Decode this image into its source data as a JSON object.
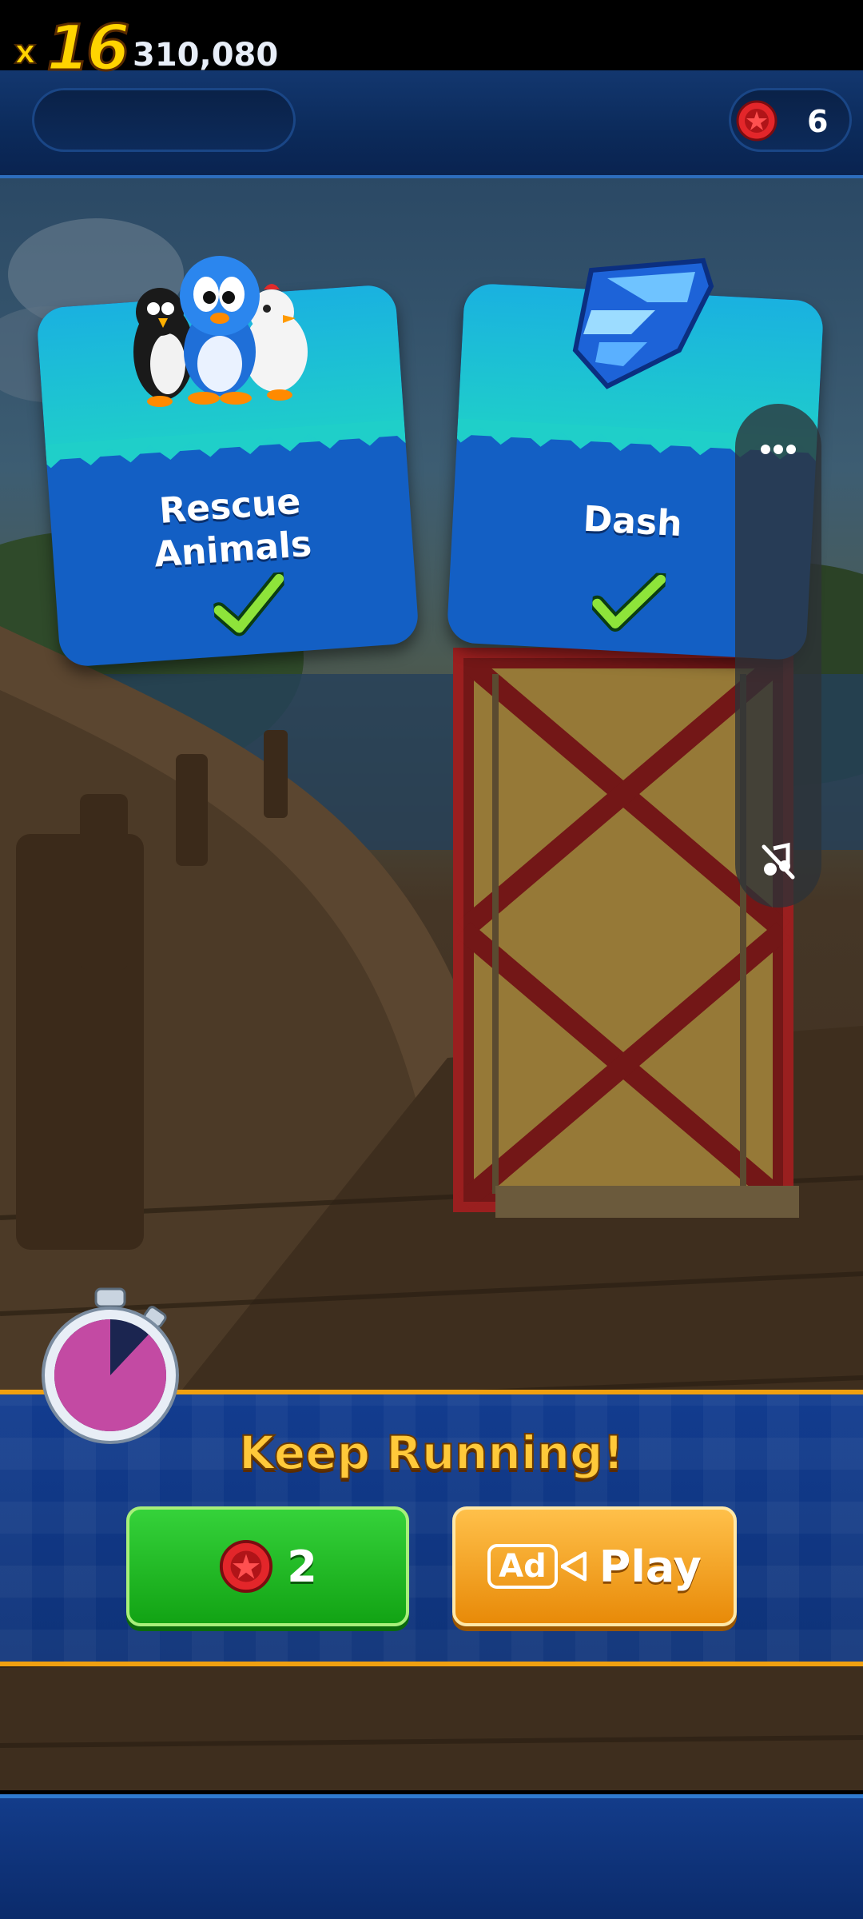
{
  "hud": {
    "multiplier_prefix": "x",
    "multiplier": "16",
    "score": "310,080",
    "red_rings": "6"
  },
  "cards": [
    {
      "label_line1": "Rescue",
      "label_line2": "Animals",
      "completed": true,
      "art": "animal-friends-icon"
    },
    {
      "label": "Dash",
      "completed": true,
      "art": "blue-crystal-icon"
    }
  ],
  "side_panel": {
    "menu_icon": "more-dots-icon",
    "mute_icon": "mute-icon"
  },
  "continue": {
    "title": "Keep Running!",
    "ring_cost": "2",
    "ad_badge": "Ad",
    "ad_label": "Play",
    "timer_remaining_fraction": 0.88
  },
  "colors": {
    "gold": "#ffc93a",
    "green": "#12a314",
    "orange": "#e88a08",
    "band_blue": "#123c8f"
  }
}
